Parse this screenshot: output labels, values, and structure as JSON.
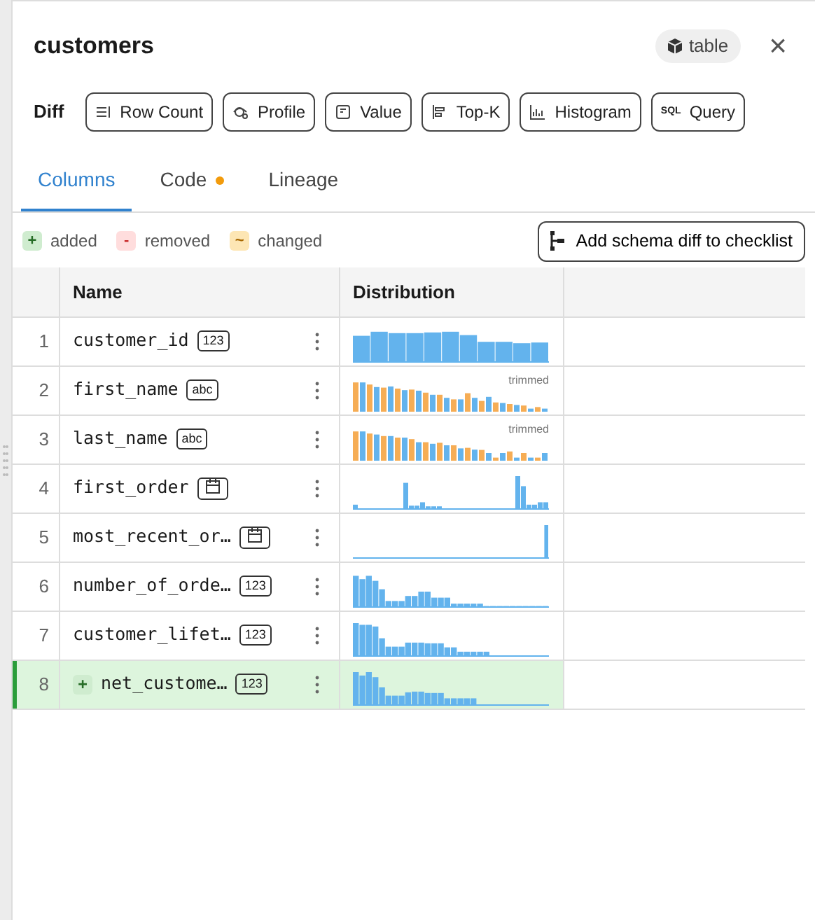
{
  "title": "customers",
  "type_chip": {
    "label": "table"
  },
  "close_icon_text": "×",
  "diff": {
    "label": "Diff",
    "buttons": [
      {
        "label": "Row Count"
      },
      {
        "label": "Profile"
      },
      {
        "label": "Value"
      },
      {
        "label": "Top-K"
      },
      {
        "label": "Histogram"
      },
      {
        "label": "Query",
        "icon_text": "SQL"
      }
    ]
  },
  "tabs": [
    {
      "label": "Columns",
      "selected": true,
      "dot": false
    },
    {
      "label": "Code",
      "selected": false,
      "dot": true
    },
    {
      "label": "Lineage",
      "selected": false,
      "dot": false
    }
  ],
  "legend": [
    {
      "kind": "added",
      "symbol": "+",
      "label": "added"
    },
    {
      "kind": "removed",
      "symbol": "-",
      "label": "removed"
    },
    {
      "kind": "changed",
      "symbol": "~",
      "label": "changed"
    }
  ],
  "checklist_button": {
    "label": "Add schema diff to checklist"
  },
  "table": {
    "columns": [
      "Name",
      "Distribution"
    ],
    "rows": [
      {
        "index": "1",
        "name": "customer_id",
        "kind": "number",
        "type_label": "123",
        "added": false,
        "distribution": {
          "kind": "histogram"
        }
      },
      {
        "index": "2",
        "name": "first_name",
        "kind": "text",
        "type_label": "abc",
        "added": false,
        "distribution": {
          "kind": "categories",
          "note": "trimmed"
        }
      },
      {
        "index": "3",
        "name": "last_name",
        "kind": "text",
        "type_label": "abc",
        "added": false,
        "distribution": {
          "kind": "categories",
          "note": "trimmed"
        }
      },
      {
        "index": "4",
        "name": "first_order",
        "kind": "date",
        "added": false,
        "distribution": {
          "kind": "histogram"
        }
      },
      {
        "index": "5",
        "name": "most_recent_or…",
        "kind": "date",
        "added": false,
        "distribution": {
          "kind": "histogram"
        }
      },
      {
        "index": "6",
        "name": "number_of_orde…",
        "kind": "number",
        "type_label": "123",
        "added": false,
        "distribution": {
          "kind": "histogram"
        }
      },
      {
        "index": "7",
        "name": "customer_lifet…",
        "kind": "number",
        "type_label": "123",
        "added": false,
        "distribution": {
          "kind": "histogram"
        }
      },
      {
        "index": "8",
        "name": "net_custome…",
        "kind": "number",
        "type_label": "123",
        "added": true,
        "added_symbol": "+",
        "distribution": {
          "kind": "histogram"
        }
      }
    ]
  }
}
